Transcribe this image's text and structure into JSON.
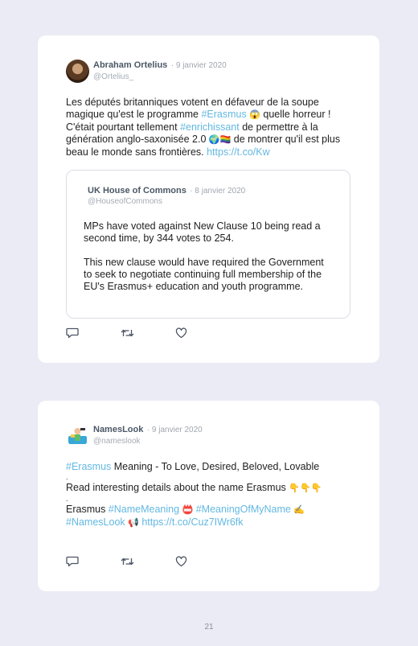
{
  "tweets": [
    {
      "author_name": "Abraham Ortelius",
      "date": "· 9 janvier 2020",
      "handle": "@Ortelius_",
      "body": {
        "p1": "Les députés britanniques votent en défaveur de la soupe magique qu'est le programme ",
        "hashtag1": "#Erasmus",
        "emoji1": "😱",
        "p2": " quelle horreur ! C'était pourtant tellement ",
        "hashtag2": "#enrichissant",
        "p3": " de permettre à la génération anglo-saxonisée 2.0 ",
        "emoji2": "🌍🏳️‍🌈",
        "p4": " de montrer qu'il est plus beau le monde sans frontières. ",
        "link": "https://t.co/Kw"
      },
      "quoted": {
        "author_name": "UK House of Commons",
        "date": "· 8 janvier 2020",
        "handle": "@HouseofCommons",
        "paragraph1": "MPs have voted against New Clause 10 being read a second time, by 344 votes to 254.",
        "paragraph2": "This new clause would have required the Government to seek to negotiate continuing full membership of the EU's Erasmus+ education and youth programme."
      }
    },
    {
      "author_name": "NamesLook",
      "date": "· 9 janvier 2020",
      "handle": "@nameslook",
      "body": {
        "hashtag1": "#Erasmus",
        "line1": " Meaning - To Love, Desired, Beloved, Lovable",
        "dot1": ".",
        "line2": "Read interesting details about the name Erasmus ",
        "emoji1": "👇👇👇",
        "dot2": ".",
        "word": "Erasmus ",
        "hashtag2": "#NameMeaning",
        "emoji2": "📛",
        "hashtag3": "#MeaningOfMyName",
        "emoji3": "✍️",
        "hashtag4": "#NamesLook",
        "emoji4": "📢",
        "link": "https://t.co/Cuz7IWr6fk"
      }
    }
  ],
  "icons": [
    "reply-icon",
    "retweet-icon",
    "like-icon"
  ],
  "colors": {
    "link": "#63b8e2",
    "background": "#eaebf4",
    "card": "#ffffff"
  },
  "page_number": "21"
}
